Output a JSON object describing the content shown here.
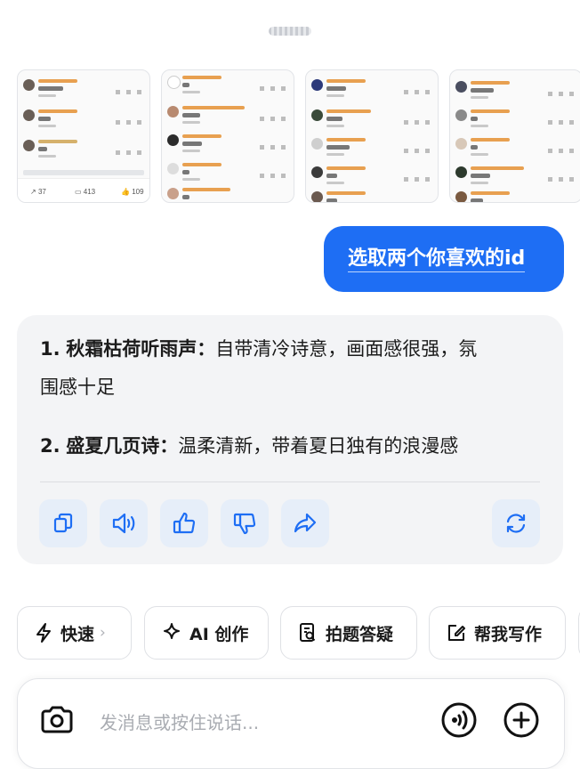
{
  "thumbnails": [
    {
      "likes_count": "",
      "repost_count": "37",
      "comment_count": "413",
      "like_count": "109"
    },
    {},
    {},
    {}
  ],
  "user_message": "选取两个你喜欢的id",
  "answer": {
    "items": [
      {
        "num": "1.",
        "name": "秋霜枯荷听雨声",
        "sep": "：",
        "desc_line1": "自带清冷诗意，画面感很强，氛",
        "desc_line2": "围感十足"
      },
      {
        "num": "2.",
        "name": "盛夏几页诗",
        "sep": "：",
        "desc_line1": "温柔清新，带着夏日独有的浪漫感"
      }
    ],
    "actions": [
      "copy-icon",
      "speaker-icon",
      "thumbs-up-icon",
      "thumbs-down-icon",
      "share-icon",
      "regenerate-icon"
    ]
  },
  "chips": [
    {
      "label": "快速",
      "icon": "lightning-icon",
      "chevron": "›"
    },
    {
      "label": "AI 创作",
      "icon": "sparkle-icon"
    },
    {
      "label": "拍题答疑",
      "icon": "scan-question-icon"
    },
    {
      "label": "帮我写作",
      "icon": "edit-icon"
    }
  ],
  "input": {
    "placeholder": "发消息或按住说话..."
  },
  "colors": {
    "accent": "#1e6ef4",
    "answer_bg": "#f3f4f6",
    "action_bg": "#e6eef9"
  }
}
